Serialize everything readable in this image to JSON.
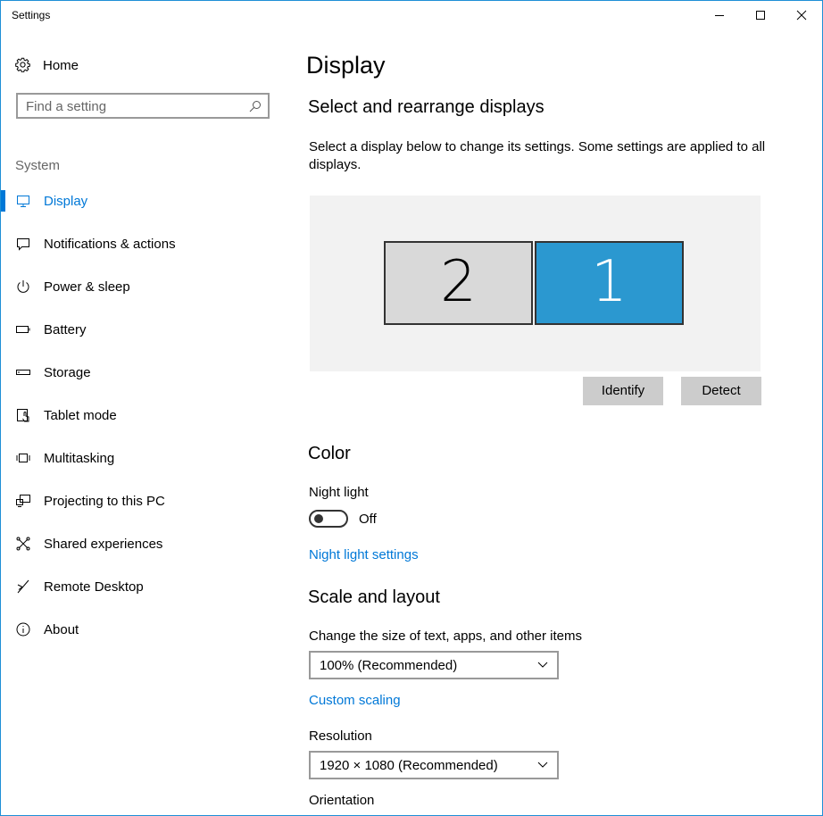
{
  "window": {
    "title": "Settings"
  },
  "sidebar": {
    "home_label": "Home",
    "search_placeholder": "Find a setting",
    "section_label": "System",
    "items": [
      {
        "label": "Display",
        "icon": "monitor-icon",
        "selected": true
      },
      {
        "label": "Notifications & actions",
        "icon": "notification-icon"
      },
      {
        "label": "Power & sleep",
        "icon": "power-icon"
      },
      {
        "label": "Battery",
        "icon": "battery-icon"
      },
      {
        "label": "Storage",
        "icon": "storage-icon"
      },
      {
        "label": "Tablet mode",
        "icon": "tablet-icon"
      },
      {
        "label": "Multitasking",
        "icon": "multitasking-icon"
      },
      {
        "label": "Projecting to this PC",
        "icon": "projecting-icon"
      },
      {
        "label": "Shared experiences",
        "icon": "shared-icon"
      },
      {
        "label": "Remote Desktop",
        "icon": "remote-desktop-icon"
      },
      {
        "label": "About",
        "icon": "info-icon"
      }
    ]
  },
  "main": {
    "page_title": "Display",
    "arrange": {
      "heading": "Select and rearrange displays",
      "description": "Select a display below to change its settings. Some settings are applied to all displays.",
      "monitors": [
        {
          "number": "2",
          "selected": false
        },
        {
          "number": "1",
          "selected": true
        }
      ],
      "identify_label": "Identify",
      "detect_label": "Detect"
    },
    "color": {
      "heading": "Color",
      "night_light_label": "Night light",
      "night_light_state": "Off",
      "night_light_settings_link": "Night light settings"
    },
    "scale": {
      "heading": "Scale and layout",
      "size_label": "Change the size of text, apps, and other items",
      "size_value": "100% (Recommended)",
      "custom_scaling_link": "Custom scaling",
      "resolution_label": "Resolution",
      "resolution_value": "1920 × 1080 (Recommended)",
      "orientation_label": "Orientation"
    }
  },
  "colors": {
    "accent": "#0078d7",
    "selected_monitor": "#2b98d0",
    "unselected_monitor": "#d9d9d9",
    "arrange_background": "#f2f2f2",
    "button_background": "#cccccc"
  }
}
